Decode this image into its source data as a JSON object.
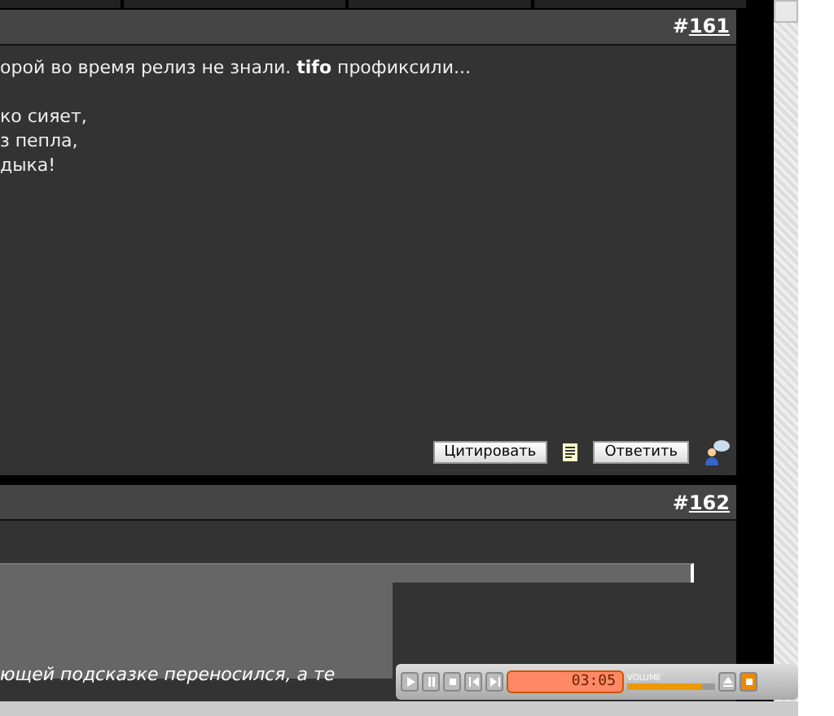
{
  "posts": [
    {
      "number_prefix": "#",
      "number": "161",
      "paragraphs": [
        [
          "орой во время релиз не знали. **tifo** профиксили..."
        ],
        [
          "ко сияет,",
          "з пепла,",
          "дыка!"
        ]
      ],
      "actions": {
        "quote": "Цитировать",
        "reply": "Ответить"
      }
    },
    {
      "number_prefix": "#",
      "number": "162",
      "quote_text": "ющей подсказке переносился, а те"
    }
  ],
  "player": {
    "time": "03:05",
    "volume_label": "VOLUME",
    "volume": {
      "level": 0.85
    }
  }
}
